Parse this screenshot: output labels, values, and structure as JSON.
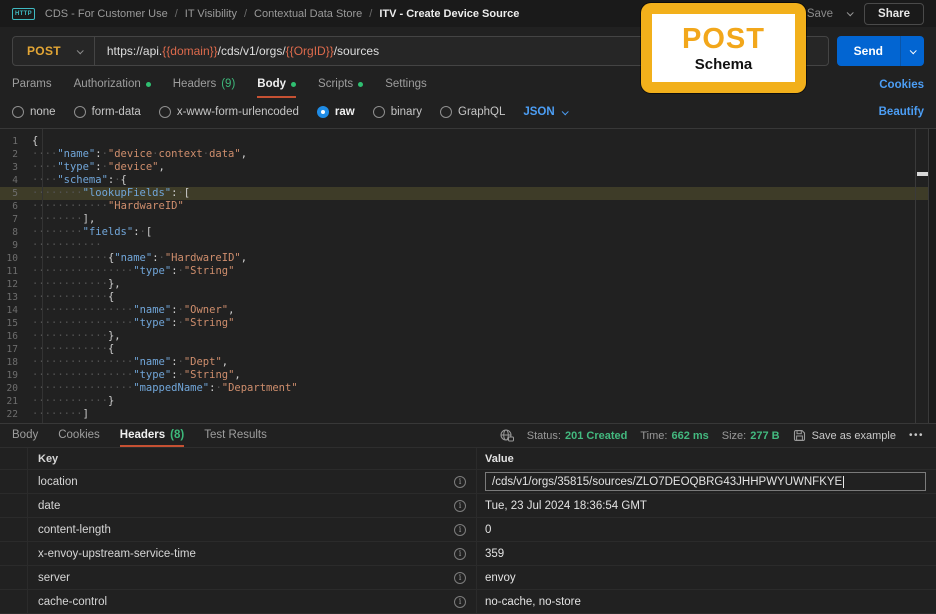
{
  "topbar": {
    "http_badge": "HTTP",
    "breadcrumb": [
      "CDS - For Customer Use",
      "IT Visibility",
      "Contextual Data Store"
    ],
    "current": "ITV - Create Device Source",
    "save_label": "Save",
    "share_label": "Share"
  },
  "request": {
    "method": "POST",
    "url": {
      "prefix": "https://api.",
      "var1": "{{domain}}",
      "mid": "/cds/v1/orgs/",
      "var2": "{{OrgID}}",
      "suffix": "/sources"
    },
    "send_label": "Send"
  },
  "request_tabs": [
    {
      "label": "Params"
    },
    {
      "label": "Authorization",
      "dot": true
    },
    {
      "label": "Headers",
      "count": "(9)"
    },
    {
      "label": "Body",
      "dot": true,
      "active": true
    },
    {
      "label": "Scripts",
      "dot": true
    },
    {
      "label": "Settings"
    }
  ],
  "cookies_link": "Cookies",
  "body_options": {
    "radios": [
      {
        "label": "none"
      },
      {
        "label": "form-data"
      },
      {
        "label": "x-www-form-urlencoded"
      },
      {
        "label": "raw",
        "checked": true
      },
      {
        "label": "binary"
      },
      {
        "label": "GraphQL"
      }
    ],
    "language": "JSON",
    "beautify_link": "Beautify"
  },
  "editor": {
    "highlight_line": 5,
    "lines": [
      "{",
      "    \"name\": \"device context data\",",
      "    \"type\": \"device\",",
      "    \"schema\": {",
      "        \"lookupFields\": [",
      "            \"HardwareID\"",
      "        ],",
      "        \"fields\": [",
      "           ",
      "            {\"name\": \"HardwareID\",",
      "                \"type\": \"String\"",
      "            },",
      "            {",
      "                \"name\": \"Owner\",",
      "                \"type\": \"String\"",
      "            },",
      "            {",
      "                \"name\": \"Dept\",",
      "                \"type\": \"String\",",
      "                \"mappedName\": \"Department\"",
      "            }",
      "        ]"
    ]
  },
  "callout": {
    "title": "POST",
    "subtitle": "Schema"
  },
  "response": {
    "tabs": [
      {
        "label": "Body"
      },
      {
        "label": "Cookies"
      },
      {
        "label": "Headers",
        "count": "(8)",
        "active": true
      },
      {
        "label": "Test Results"
      }
    ],
    "meta": {
      "status_label": "Status:",
      "status_value": "201 Created",
      "time_label": "Time:",
      "time_value": "662 ms",
      "size_label": "Size:",
      "size_value": "277 B",
      "save_as_example": "Save as example",
      "more": "•••"
    },
    "table": {
      "key_header": "Key",
      "value_header": "Value",
      "rows": [
        {
          "key": "location",
          "value": "/cds/v1/orgs/35815/sources/ZLO7DEOQBRG43JHHPWYUWNFKYE",
          "selected": true
        },
        {
          "key": "date",
          "value": "Tue, 23 Jul 2024 18:36:54 GMT"
        },
        {
          "key": "content-length",
          "value": "0"
        },
        {
          "key": "x-envoy-upstream-service-time",
          "value": "359"
        },
        {
          "key": "server",
          "value": "envoy"
        },
        {
          "key": "cache-control",
          "value": "no-cache, no-store"
        }
      ]
    }
  },
  "colors": {
    "accent_orange": "#c65133",
    "method_yellow": "#e3a635",
    "variable_orange": "#dd6a4c",
    "link_blue": "#4c9ef5",
    "success_green": "#3db87a",
    "send_blue": "#0265d2",
    "callout_yellow": "#f2b01b"
  }
}
